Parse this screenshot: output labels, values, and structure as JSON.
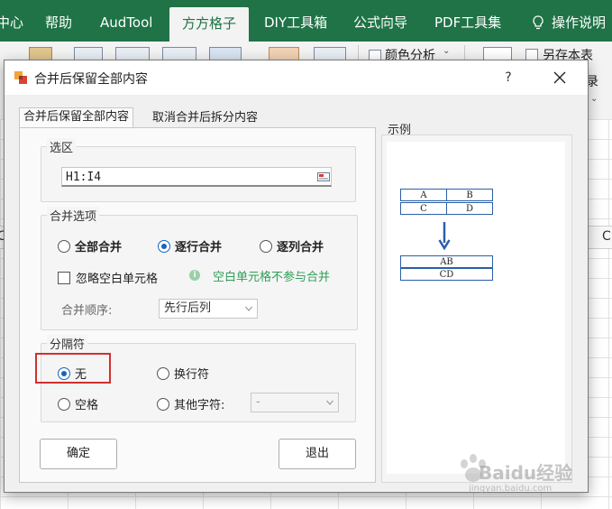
{
  "excel": {
    "ribbon_tabs": [
      "中心",
      "帮助",
      "AudTool",
      "方方格子",
      "DIY工具箱",
      "公式向导",
      "PDF工具集",
      "操作说明"
    ],
    "active_tab": "方方格子",
    "ribbon_items": {
      "color_analysis": "颜色分析",
      "save_as": "另存本表",
      "record": "录"
    },
    "column_letters": [
      "C",
      "C"
    ]
  },
  "dialog": {
    "title": "合并后保留全部内容",
    "help": "?",
    "tabs": [
      {
        "label": "合并后保留全部内容",
        "active": true
      },
      {
        "label": "取消合并后拆分内容",
        "active": false
      }
    ],
    "selection": {
      "label": "选区",
      "value": "H1:I4"
    },
    "merge_options": {
      "label": "合并选项",
      "modes": [
        {
          "label": "全部合并",
          "selected": false
        },
        {
          "label": "逐行合并",
          "selected": true
        },
        {
          "label": "逐列合并",
          "selected": false
        }
      ],
      "ignore_blank": {
        "label": "忽略空白单元格",
        "checked": false
      },
      "hint": "空白单元格不参与合并",
      "order_label": "合并顺序:",
      "order_value": "先行后列"
    },
    "separator": {
      "label": "分隔符",
      "options": [
        {
          "label": "无",
          "selected": true
        },
        {
          "label": "换行符",
          "selected": false
        },
        {
          "label": "空格",
          "selected": false
        },
        {
          "label": "其他字符:",
          "selected": false
        }
      ],
      "other_value": "-"
    },
    "buttons": {
      "ok": "确定",
      "exit": "退出"
    },
    "example": {
      "label": "示例",
      "before": [
        [
          "A",
          "B"
        ],
        [
          "C",
          "D"
        ]
      ],
      "after": [
        "AB",
        "CD"
      ]
    }
  },
  "watermark": {
    "brand": "Baidu经验",
    "url": "jingyan.baidu.com"
  },
  "colors": {
    "excel_green": "#1f7346",
    "radio_blue": "#1565c0",
    "hint_green": "#2e9e55",
    "highlight_red": "#d0302f",
    "example_border": "#2a5fa8"
  }
}
